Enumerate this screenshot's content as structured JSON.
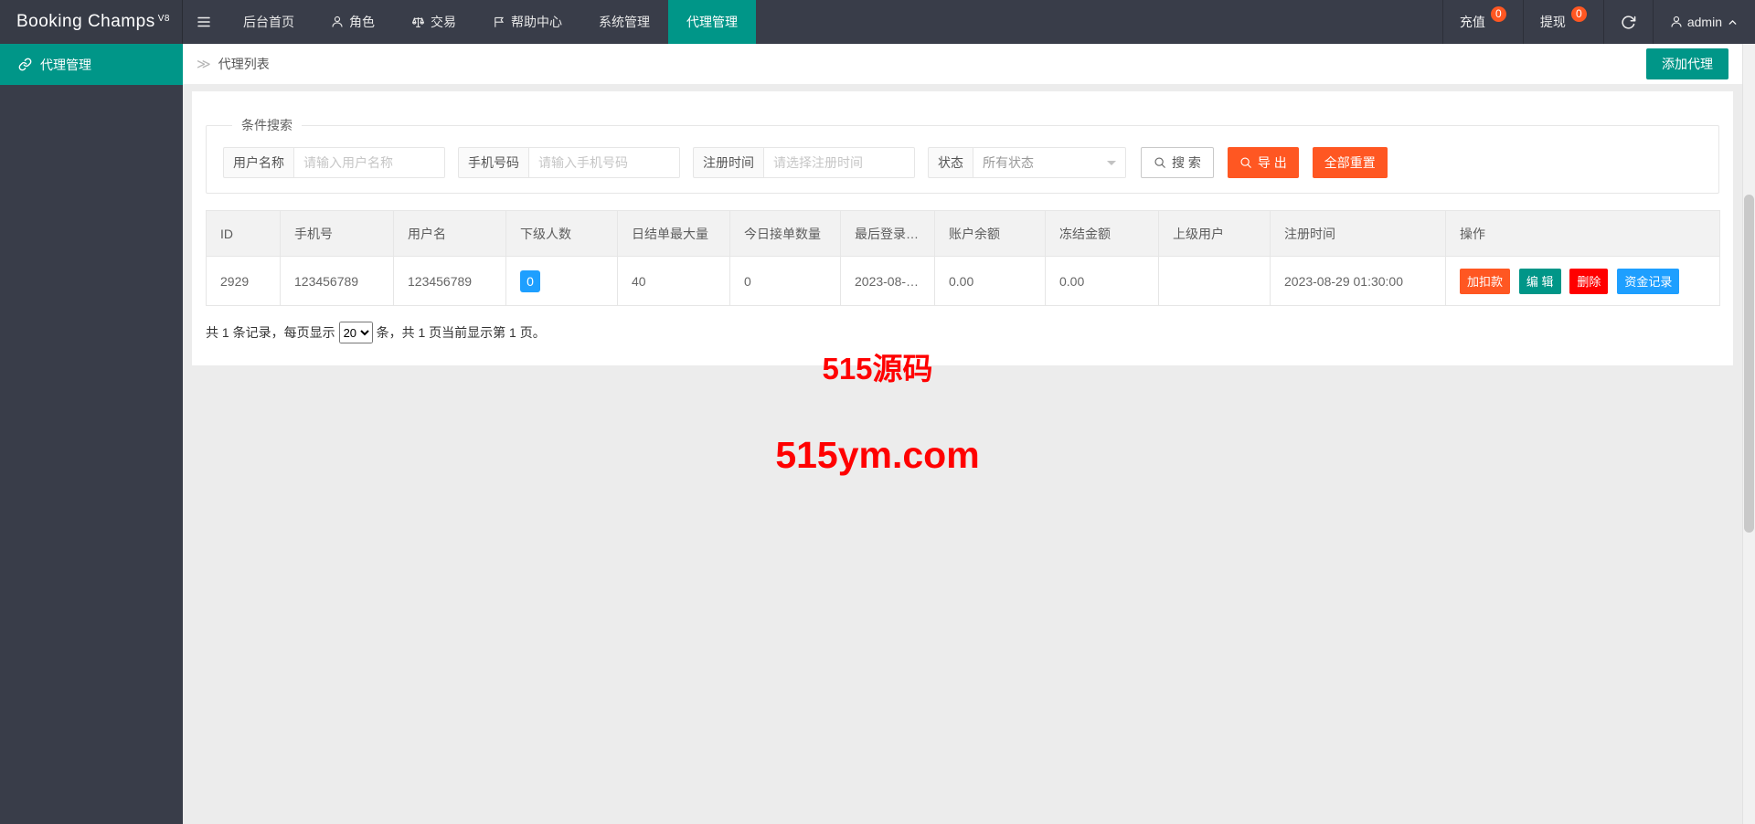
{
  "navbar": {
    "logo_text": "Booking Champs",
    "logo_version": "V8",
    "menu_items": [
      {
        "label": "后台首页"
      },
      {
        "label": "角色"
      },
      {
        "label": "交易"
      },
      {
        "label": "帮助中心"
      },
      {
        "label": "系统管理"
      },
      {
        "label": "代理管理"
      }
    ],
    "recharge": {
      "label": "充值",
      "badge": "0"
    },
    "withdraw": {
      "label": "提现",
      "badge": "0"
    },
    "user": {
      "name": "admin"
    }
  },
  "sidebar": {
    "active_item": {
      "label": "代理管理"
    }
  },
  "breadcrumb": {
    "separator": "≫",
    "current": "代理列表"
  },
  "toolbar": {
    "add_agent_label": "添加代理"
  },
  "search_panel": {
    "legend": "条件搜索",
    "username": {
      "label": "用户名称",
      "placeholder": "请输入用户名称"
    },
    "phone": {
      "label": "手机号码",
      "placeholder": "请输入手机号码"
    },
    "reg_time": {
      "label": "注册时间",
      "placeholder": "请选择注册时间"
    },
    "status": {
      "label": "状态",
      "value": "所有状态"
    },
    "search_label": "搜 索",
    "export_label": "导 出",
    "reset_label": "全部重置"
  },
  "table": {
    "headers": [
      "ID",
      "手机号",
      "用户名",
      "下级人数",
      "日结单最大量",
      "今日接单数量",
      "最后登录时...",
      "账户余额",
      "冻结金额",
      "上级用户",
      "注册时间",
      "操作"
    ],
    "row": {
      "id": "2929",
      "phone": "123456789",
      "username": "123456789",
      "subordinate_count": "0",
      "daily_order_max": "40",
      "today_order_count": "0",
      "last_login": "2023-08-2...",
      "balance": "0.00",
      "frozen_amount": "0.00",
      "parent_user": "",
      "register_time": "2023-08-29 01:30:00"
    },
    "actions": {
      "adjust": "加扣款",
      "edit": "编 辑",
      "delete": "删除",
      "funds": "资金记录"
    }
  },
  "pagination": {
    "total_prefix": "共 1 条记录，每页显示",
    "page_size": "20",
    "total_suffix": "条，共 1 页当前显示第 1 页。"
  },
  "watermark": {
    "line1": "515源码",
    "line2": "515ym.com"
  },
  "colors": {
    "accent_teal": "#009688",
    "orange": "#FF5722",
    "blue": "#1E9FFF",
    "red": "#FF0000",
    "navbar_bg": "#393D49"
  }
}
